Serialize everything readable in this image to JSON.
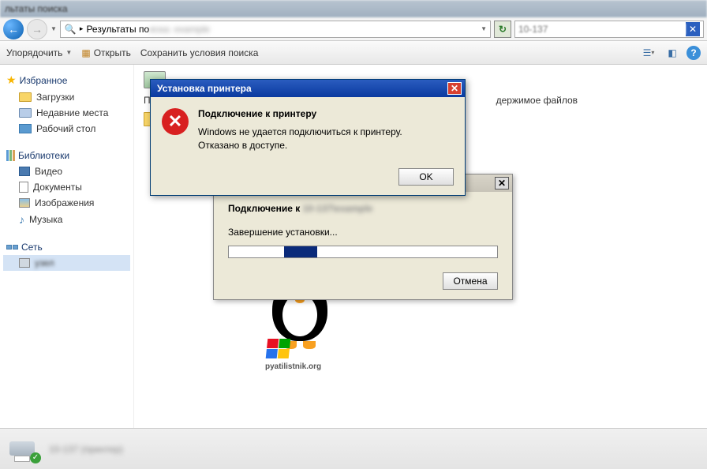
{
  "titlebar": "льтаты поиска",
  "nav": {
    "address_prefix": "Результаты по",
    "address_blur": "иска: example",
    "search_placeholder": "10-137"
  },
  "toolbar": {
    "organize": "Упорядочить",
    "open": "Открыть",
    "save_search": "Сохранить условия поиска"
  },
  "sidebar": {
    "favorites": "Избранное",
    "downloads": "Загрузки",
    "recent": "Недавние места",
    "desktop": "Рабочий стол",
    "libraries": "Библиотеки",
    "video": "Видео",
    "documents": "Документы",
    "images": "Изображения",
    "music": "Музыка",
    "network": "Сеть",
    "network_item_blur": "узел"
  },
  "content": {
    "row1_label": "Пов",
    "file_hint": "держимое файлов"
  },
  "mascot": {
    "label": "pyatilistnik.org"
  },
  "dialog_progress": {
    "title": "",
    "heading_prefix": "Подключение к",
    "heading_blur": "10-137\\example",
    "status": "Завершение установки...",
    "cancel": "Отмена"
  },
  "dialog_error": {
    "title": "Установка принтера",
    "heading": "Подключение к принтеру",
    "message_line1": "Windows не удается подключиться к принтеру.",
    "message_line2": "Отказано в доступе.",
    "ok": "OK"
  },
  "statusbar": {
    "text_blur": "10-137 (принтер)"
  }
}
